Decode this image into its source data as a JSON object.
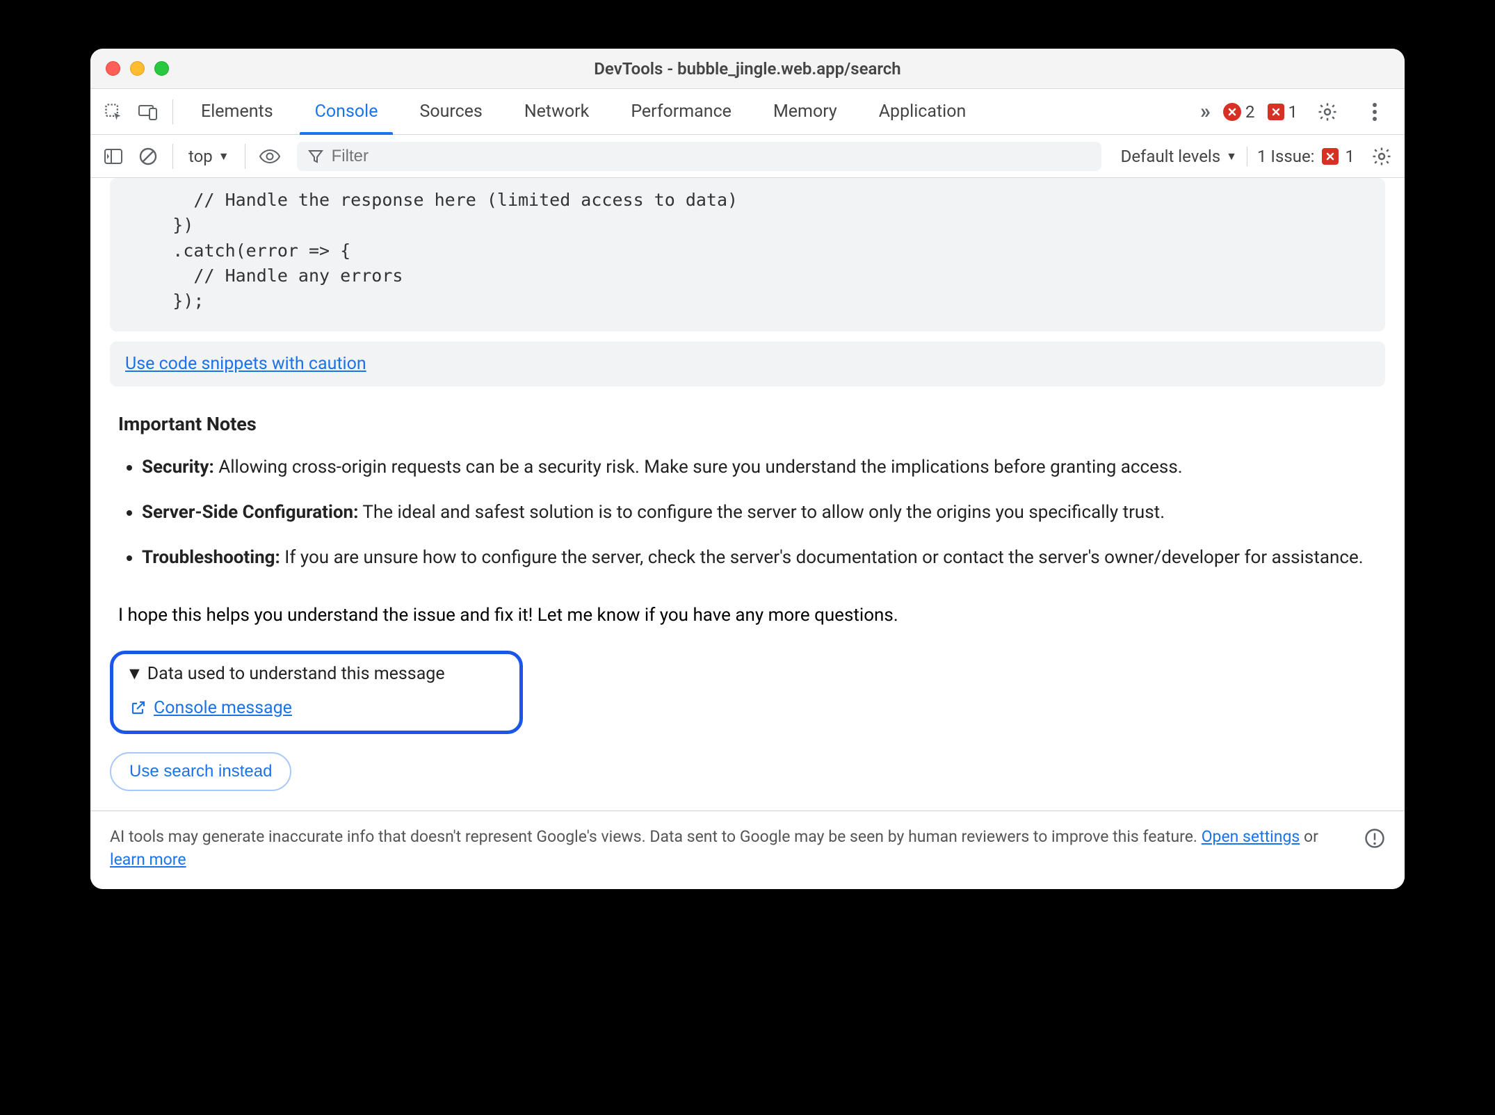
{
  "window": {
    "title": "DevTools - bubble_jingle.web.app/search"
  },
  "tabs": {
    "items": [
      "Elements",
      "Console",
      "Sources",
      "Network",
      "Performance",
      "Memory",
      "Application"
    ],
    "active": "Console",
    "overflow_icon": ">>",
    "error_count": "2",
    "issue_count": "1"
  },
  "filterbar": {
    "context": "top",
    "filter_placeholder": "Filter",
    "levels_label": "Default levels",
    "issues_label": "1 Issue:",
    "issues_count": "1"
  },
  "code": {
    "line1": "        // Handle the response here (limited access to data)",
    "line2": "      })",
    "line3": "      .catch(error => {",
    "line4": "        // Handle any errors",
    "line5": "      });"
  },
  "caution_link": "Use code snippets with caution",
  "notes": {
    "heading": "Important Notes",
    "item1_bold": "Security:",
    "item1_text": " Allowing cross-origin requests can be a security risk. Make sure you understand the implications before granting access.",
    "item2_bold": "Server-Side Configuration:",
    "item2_text": " The ideal and safest solution is to configure the server to allow only the origins you specifically trust.",
    "item3_bold": "Troubleshooting:",
    "item3_text": " If you are unsure how to configure the server, check the server's documentation or contact the server's owner/developer for assistance."
  },
  "closing_text": "I hope this helps you understand the issue and fix it! Let me know if you have any more questions.",
  "databox": {
    "summary": "Data used to understand this message",
    "link": "Console message"
  },
  "search_button": "Use search instead",
  "footer": {
    "text_before": "AI tools may generate inaccurate info that doesn't represent Google's views. Data sent to Google may be seen by human reviewers to improve this feature. ",
    "open_settings": "Open settings",
    "or": " or ",
    "learn_more": "learn more"
  }
}
